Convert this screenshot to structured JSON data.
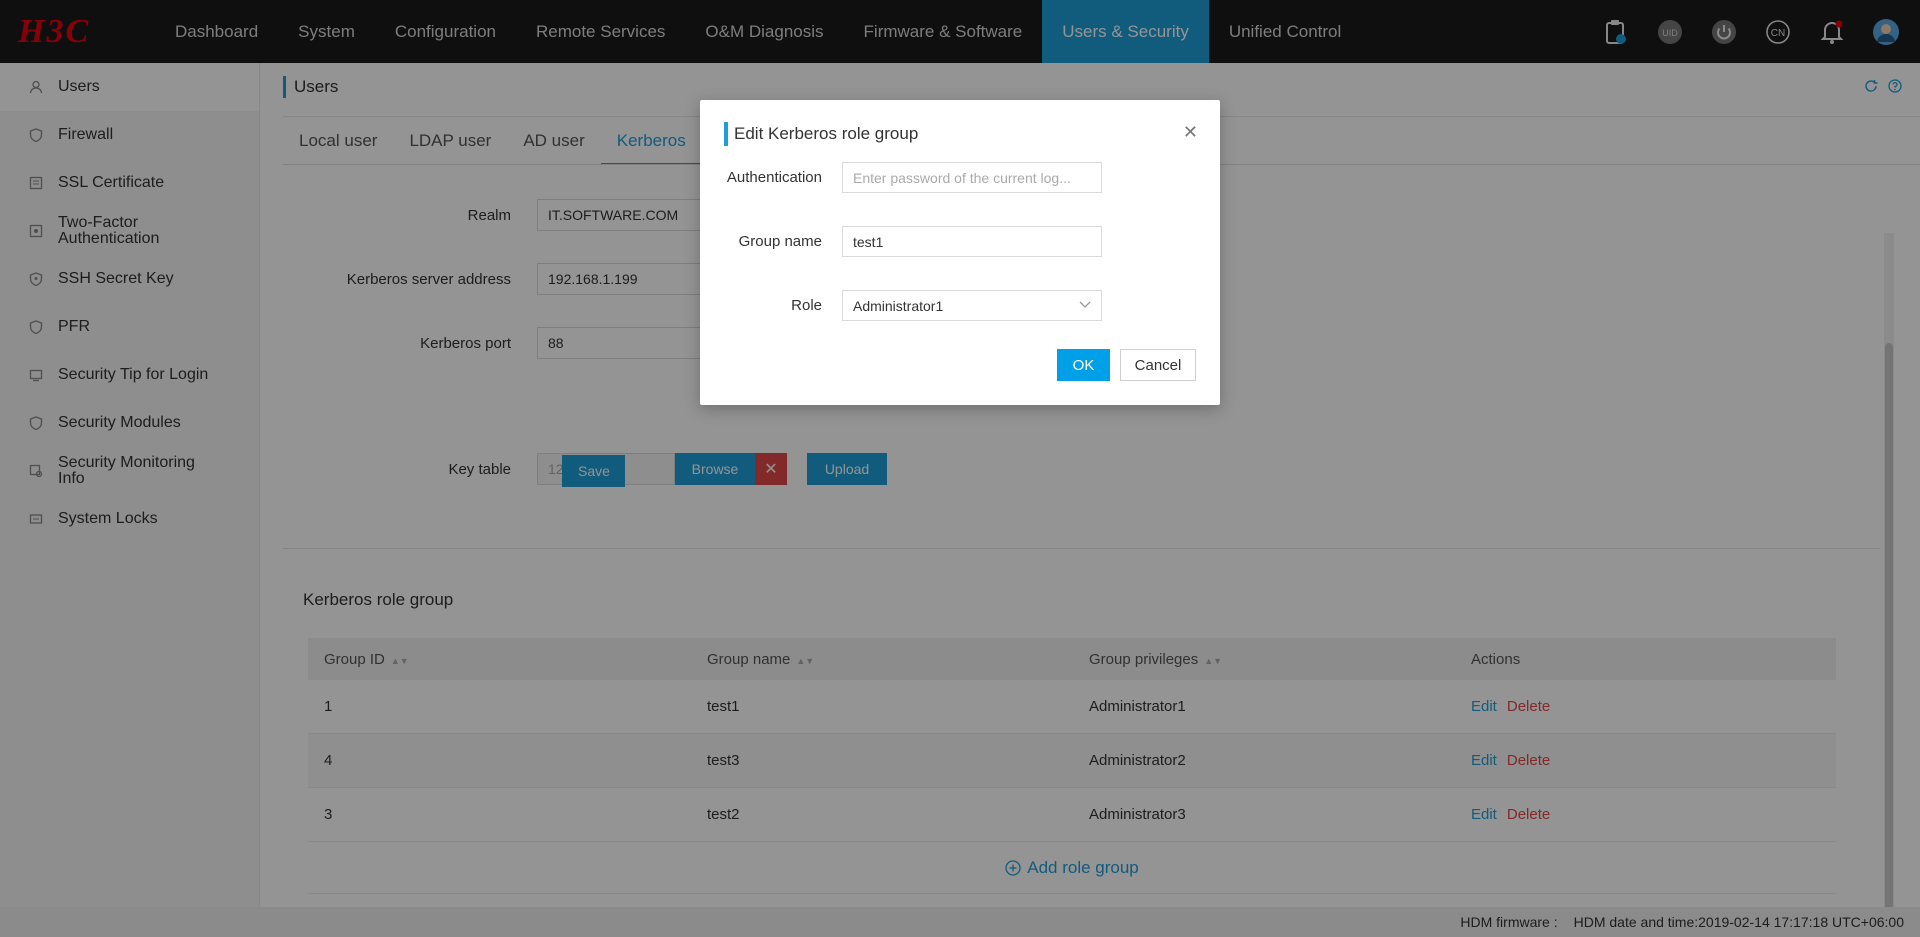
{
  "brand": {
    "logo": "H3C",
    "logo_color": "#e60012"
  },
  "nav": {
    "items": [
      {
        "label": "Dashboard"
      },
      {
        "label": "System"
      },
      {
        "label": "Configuration"
      },
      {
        "label": "Remote Services"
      },
      {
        "label": "O&M Diagnosis"
      },
      {
        "label": "Firmware & Software"
      },
      {
        "label": "Users & Security"
      },
      {
        "label": "Unified Control"
      }
    ],
    "active": "Users & Security",
    "accent": "#1e9fd6",
    "icons": {
      "uid": "UID",
      "lang": "CN"
    }
  },
  "sidebar": {
    "items": [
      {
        "label": "Users",
        "icon": "user-icon"
      },
      {
        "label": "Firewall",
        "icon": "shield-icon"
      },
      {
        "label": "SSL Certificate",
        "icon": "certificate-icon"
      },
      {
        "label": "Two-Factor Authentication",
        "icon": "two-factor-icon"
      },
      {
        "label": "SSH Secret Key",
        "icon": "key-icon"
      },
      {
        "label": "PFR",
        "icon": "pfr-icon"
      },
      {
        "label": "Security Tip for Login",
        "icon": "tip-icon"
      },
      {
        "label": "Security Modules",
        "icon": "module-icon"
      },
      {
        "label": "Security Monitoring Info",
        "icon": "monitor-icon"
      },
      {
        "label": "System Locks",
        "icon": "lock-icon"
      }
    ]
  },
  "page": {
    "title": "Users",
    "tabs": [
      {
        "label": "Local user"
      },
      {
        "label": "LDAP user"
      },
      {
        "label": "AD user"
      },
      {
        "label": "Kerberos"
      }
    ],
    "active_tab": "Kerberos"
  },
  "form": {
    "realm_label": "Realm",
    "realm_value": "IT.SOFTWARE.COM",
    "server_label": "Kerberos server address",
    "server_value": "192.168.1.199",
    "port_label": "Kerberos port",
    "port_value": "88",
    "keytab_label": "Key table",
    "keytab_value": "1231.keytab",
    "browse_label": "Browse",
    "upload_label": "Upload",
    "save_label": "Save"
  },
  "role_group": {
    "section_title": "Kerberos role group",
    "columns": [
      "Group ID",
      "Group name",
      "Group privileges",
      "Actions"
    ],
    "rows": [
      {
        "id": "1",
        "name": "test1",
        "privileges": "Administrator1",
        "edit": "Edit",
        "delete": "Delete"
      },
      {
        "id": "4",
        "name": "test3",
        "privileges": "Administrator2",
        "edit": "Edit",
        "delete": "Delete"
      },
      {
        "id": "3",
        "name": "test2",
        "privileges": "Administrator3",
        "edit": "Edit",
        "delete": "Delete"
      }
    ],
    "add_label": "Add role group"
  },
  "footer": {
    "firmware": "HDM firmware :",
    "datetime": "HDM date and time:2019-02-14 17:17:18 UTC+06:00"
  },
  "modal": {
    "title": "Edit Kerberos role group",
    "auth_label": "Authentication",
    "auth_placeholder": "Enter password of the current log...",
    "group_label": "Group name",
    "group_value": "test1",
    "role_label": "Role",
    "role_value": "Administrator1",
    "ok_label": "OK",
    "cancel_label": "Cancel"
  }
}
